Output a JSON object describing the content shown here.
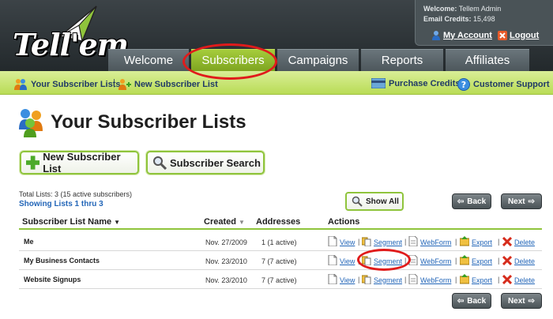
{
  "brand": {
    "logo_text": "Tell'em"
  },
  "user": {
    "welcome_label": "Welcome:",
    "welcome_name": "Tellem Admin",
    "credits_label": "Email Credits:",
    "credits_value": "15,498",
    "my_account": "My Account",
    "logout": "Logout"
  },
  "tabs": [
    {
      "label": "Welcome"
    },
    {
      "label": "Subscribers"
    },
    {
      "label": "Campaigns"
    },
    {
      "label": "Reports"
    },
    {
      "label": "Affiliates"
    }
  ],
  "subnav": {
    "your_lists": "Your Subscriber Lists",
    "separator": "|",
    "new_list": "New Subscriber List",
    "purchase_credits": "Purchase Credits",
    "customer_support": "Customer Support"
  },
  "page": {
    "title": "Your Subscriber Lists",
    "new_list_button": "New Subscriber List",
    "search_button": "Subscriber Search",
    "total_lists": "Total Lists: 3 (15 active subscribers)",
    "showing": "Showing Lists 1 thru 3",
    "show_all": "Show All",
    "back": "Back",
    "next": "Next"
  },
  "table": {
    "columns": [
      "Subscriber List Name",
      "Created",
      "Addresses",
      "Actions"
    ],
    "actions": [
      "View",
      "Segment",
      "WebForm",
      "Export",
      "Delete"
    ],
    "rows": [
      {
        "name": "Me",
        "created": "Nov. 27/2009",
        "addresses": "1 (1 active)"
      },
      {
        "name": "My Business Contacts",
        "created": "Nov. 23/2010",
        "addresses": "7 (7 active)"
      },
      {
        "name": "Website Signups",
        "created": "Nov. 23/2010",
        "addresses": "7 (7 active)"
      }
    ]
  },
  "colors": {
    "accent_green": "#8fc43c",
    "link_blue": "#2366b8",
    "annotation_red": "#e01b1b"
  }
}
